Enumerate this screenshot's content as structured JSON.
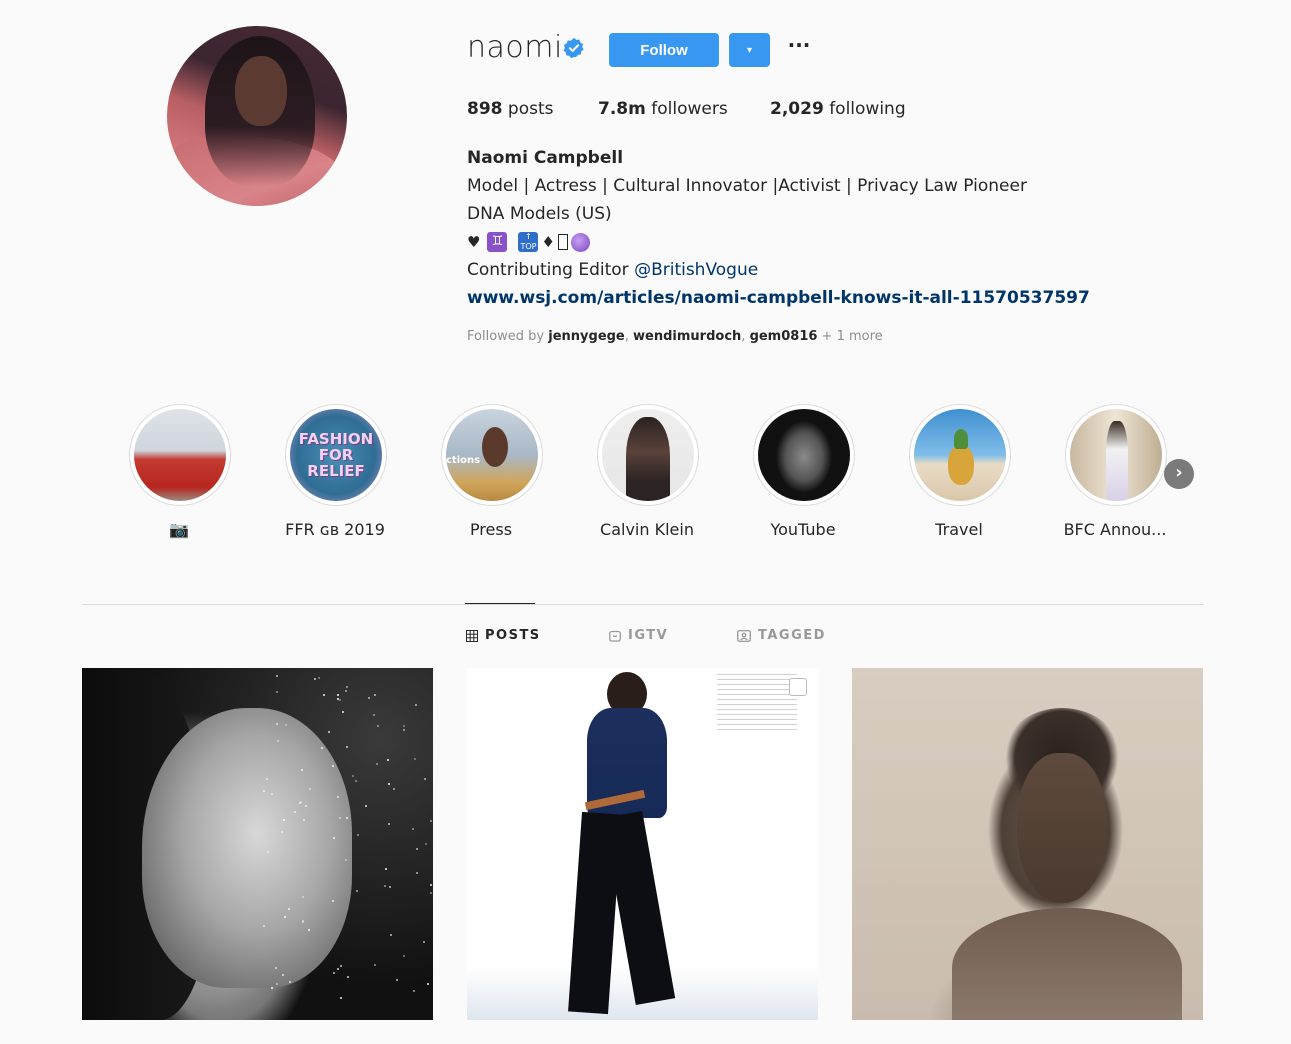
{
  "profile": {
    "username": "naomi",
    "verified": true,
    "follow_label": "Follow",
    "dropdown_icon": "▾",
    "more_icon": "···",
    "stats": {
      "posts_count": "898",
      "posts_label": "posts",
      "followers_count": "7.8m",
      "followers_label": "followers",
      "following_count": "2,029",
      "following_label": "following"
    },
    "full_name": "Naomi Campbell",
    "bio_line1": "Model | Actress | Cultural Innovator |Activist | Privacy Law Pioneer",
    "bio_line2": "DNA Models (US)",
    "emoji_line": [
      "♥",
      "♊",
      "🔝",
      "♦",
      "▯",
      "🔮"
    ],
    "bio_line4_prefix": "Contributing Editor ",
    "bio_line4_mention": "@BritishVogue",
    "website": "www.wsj.com/articles/naomi-campbell-knows-it-all-11570537597",
    "followed_by_prefix": "Followed by ",
    "followed_by_users": [
      "jennygege",
      "wendimurdoch",
      "gem0816"
    ],
    "followed_by_more": " + 1 more"
  },
  "highlights": [
    {
      "label": "📷"
    },
    {
      "label": "FFR ɢʙ 2019"
    },
    {
      "label": "Press"
    },
    {
      "label": "Calvin Klein"
    },
    {
      "label": "YouTube"
    },
    {
      "label": "Travel"
    },
    {
      "label": "BFC Annou..."
    }
  ],
  "highlight_thumb_text": {
    "ffr": "FASHION FOR RELIEF",
    "press": "ctions"
  },
  "next_icon": "›",
  "tabs": [
    {
      "label": "POSTS",
      "icon": "grid-icon",
      "active": true
    },
    {
      "label": "IGTV",
      "icon": "igtv-icon",
      "active": false
    },
    {
      "label": "TAGGED",
      "icon": "tagged-icon",
      "active": false
    }
  ],
  "colors": {
    "accent": "#3897f0",
    "link": "#003569",
    "muted": "#8e8e8e",
    "background": "#fafafa"
  }
}
